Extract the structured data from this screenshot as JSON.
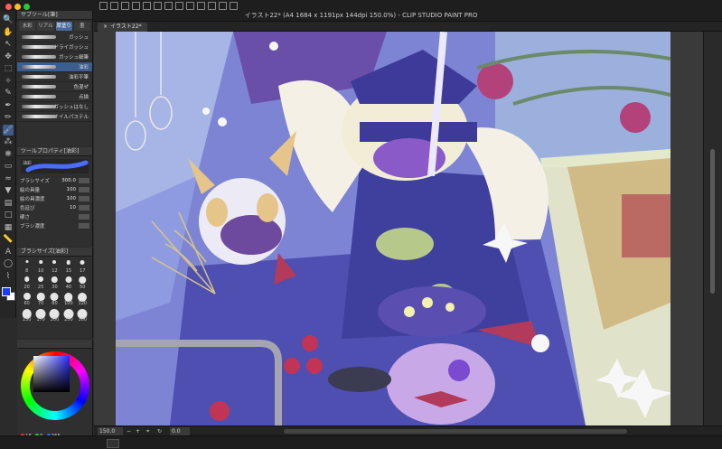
{
  "window": {
    "title": "イラスト22* (A4 1684 x 1191px 144dpi 150.0%) - CLIP STUDIO PAINT PRO"
  },
  "colors": {
    "accent": "#3c5d8f",
    "main_color": "#1b3cff",
    "sub_color": "#ffffff"
  },
  "subtool_panel": {
    "header": "サブツール[筆]",
    "tabs": [
      {
        "label": "水彩",
        "selected": false
      },
      {
        "label": "リアル",
        "selected": false
      },
      {
        "label": "厚塗り",
        "selected": true
      },
      {
        "label": "墨",
        "selected": false
      }
    ],
    "brushes": [
      {
        "name": "ガッシュ",
        "selected": false
      },
      {
        "name": "ドライガッシュ",
        "selected": false
      },
      {
        "name": "ガッシュ細筆",
        "selected": false
      },
      {
        "name": "油彩",
        "selected": true
      },
      {
        "name": "油彩平筆",
        "selected": false
      },
      {
        "name": "色混ぜ",
        "selected": false
      },
      {
        "name": "点描",
        "selected": false
      },
      {
        "name": "ガッシュはなし",
        "selected": false
      },
      {
        "name": "オイルパステル",
        "selected": false
      }
    ]
  },
  "tool_property": {
    "header": "ツールプロパティ[油彩]",
    "preview_label": "油彩",
    "rows": [
      {
        "label": "ブラシサイズ",
        "value": "300.0"
      },
      {
        "label": "絵の具量",
        "value": "100"
      },
      {
        "label": "絵の具濃度",
        "value": "100"
      },
      {
        "label": "色延び",
        "value": "10"
      },
      {
        "label": "硬さ",
        "value": ""
      },
      {
        "label": "ブラシ濃度",
        "value": ""
      }
    ]
  },
  "brush_size_panel": {
    "header": "ブラシサイズ[油彩]",
    "sizes": [
      "8",
      "10",
      "12",
      "15",
      "17",
      "20",
      "25",
      "30",
      "40",
      "50",
      "60",
      "70",
      "80",
      "100",
      "120",
      "150",
      "170",
      "200",
      "250",
      "300"
    ]
  },
  "color_panel": {
    "readout": {
      "r": "16",
      "g": "0",
      "b": "265"
    }
  },
  "document_tab": {
    "label": "イラスト22*"
  },
  "status": {
    "zoom": "150.0",
    "angle": "0.0"
  },
  "tools": [
    {
      "icon": "zoom-icon",
      "glyph": "🔍"
    },
    {
      "icon": "hand-icon",
      "glyph": "✋"
    },
    {
      "icon": "operation-icon",
      "glyph": "↖"
    },
    {
      "icon": "move-icon",
      "glyph": "✥"
    },
    {
      "icon": "select-icon",
      "glyph": "⬚"
    },
    {
      "icon": "wand-icon",
      "glyph": "✧"
    },
    {
      "icon": "eyedropper-icon",
      "glyph": "✎"
    },
    {
      "icon": "pen-icon",
      "glyph": "✒"
    },
    {
      "icon": "pencil-icon",
      "glyph": "✏"
    },
    {
      "icon": "brush-icon",
      "glyph": "🖌"
    },
    {
      "icon": "airbrush-icon",
      "glyph": "⁂"
    },
    {
      "icon": "decoration-icon",
      "glyph": "❋"
    },
    {
      "icon": "eraser-icon",
      "glyph": "▭"
    },
    {
      "icon": "blend-icon",
      "glyph": "≈"
    },
    {
      "icon": "fill-icon",
      "glyph": "▼"
    },
    {
      "icon": "gradient-icon",
      "glyph": "▤"
    },
    {
      "icon": "figure-icon",
      "glyph": "□"
    },
    {
      "icon": "frame-icon",
      "glyph": "▦"
    },
    {
      "icon": "ruler-icon",
      "glyph": "📏"
    },
    {
      "icon": "text-icon",
      "glyph": "A"
    },
    {
      "icon": "balloon-icon",
      "glyph": "◯"
    },
    {
      "icon": "correct-line-icon",
      "glyph": "⌇"
    }
  ]
}
